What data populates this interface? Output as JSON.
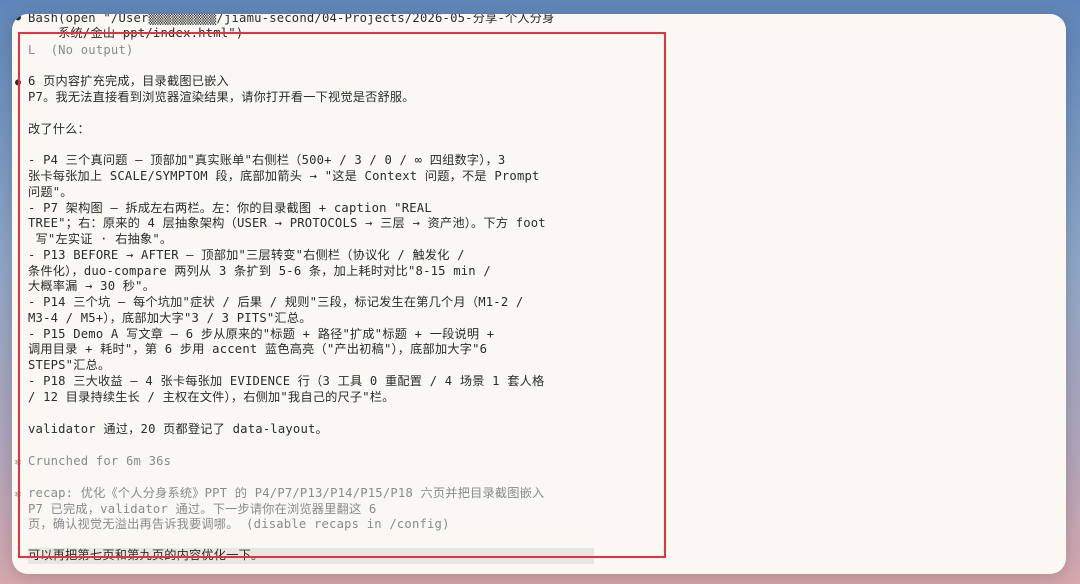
{
  "terminal": {
    "bash_cmd_1": "Bash(open \"/User▒▒▒▒▒▒▒▒▒/jiamu-second/04-Projects/2026-05-分享-个人分身",
    "bash_cmd_2": "    系统/金山 ppt/index.html\")",
    "no_output": "L  (No output)",
    "msg": [
      "6 页内容扩充完成，目录截图已嵌入",
      "P7。我无法直接看到浏览器渲染结果，请你打开看一下视觉是否舒服。",
      "",
      "改了什么：",
      "",
      "- P4 三个真问题 — 顶部加\"真实账单\"右侧栏（500+ / 3 / 0 / ∞ 四组数字），3",
      "张卡每张加上 SCALE/SYMPTOM 段，底部加箭头 → \"这是 Context 问题，不是 Prompt",
      "问题\"。",
      "- P7 架构图 — 拆成左右两栏。左：你的目录截图 + caption \"REAL",
      "TREE\"；右：原来的 4 层抽象架构（USER → PROTOCOLS → 三层 → 资产池）。下方 foot",
      " 写\"左实证 · 右抽象\"。",
      "- P13 BEFORE → AFTER — 顶部加\"三层转变\"右侧栏（协议化 / 触发化 /",
      "条件化），duo-compare 两列从 3 条扩到 5-6 条，加上耗时对比\"8-15 min /",
      "大概率漏 → 30 秒\"。",
      "- P14 三个坑 — 每个坑加\"症状 / 后果 / 规则\"三段，标记发生在第几个月（M1-2 /",
      "M3-4 / M5+），底部加大字\"3 / 3 PITS\"汇总。",
      "- P15 Demo A 写文章 — 6 步从原来的\"标题 + 路径\"扩成\"标题 + 一段说明 +",
      "调用目录 + 耗时\"，第 6 步用 accent 蓝色高亮（\"产出初稿\"），底部加大字\"6",
      "STEPS\"汇总。",
      "- P18 三大收益 — 4 张卡每张加 EVIDENCE 行（3 工具 0 重配置 / 4 场景 1 套人格",
      "/ 12 目录持续生长 / 主权在文件），右侧加\"我自己的尺子\"栏。",
      "",
      "validator 通过，20 页都登记了 data-layout。"
    ],
    "crunched": "Crunched for 6m 36s",
    "recap": [
      "recap: 优化《个人分身系统》PPT 的 P4/P7/P13/P14/P15/P18 六页并把目录截图嵌入",
      "P7 已完成，validator 通过。下一步请你在浏览器里翻这 6",
      "页，确认视觉无溢出再告诉我要调哪。 (disable recaps in /config)"
    ],
    "input": "可以再把第七页和第九页的内容优化一下。"
  },
  "colors": {
    "highlight_box": "#e5323f",
    "window_bg": "#fbf8f4"
  }
}
